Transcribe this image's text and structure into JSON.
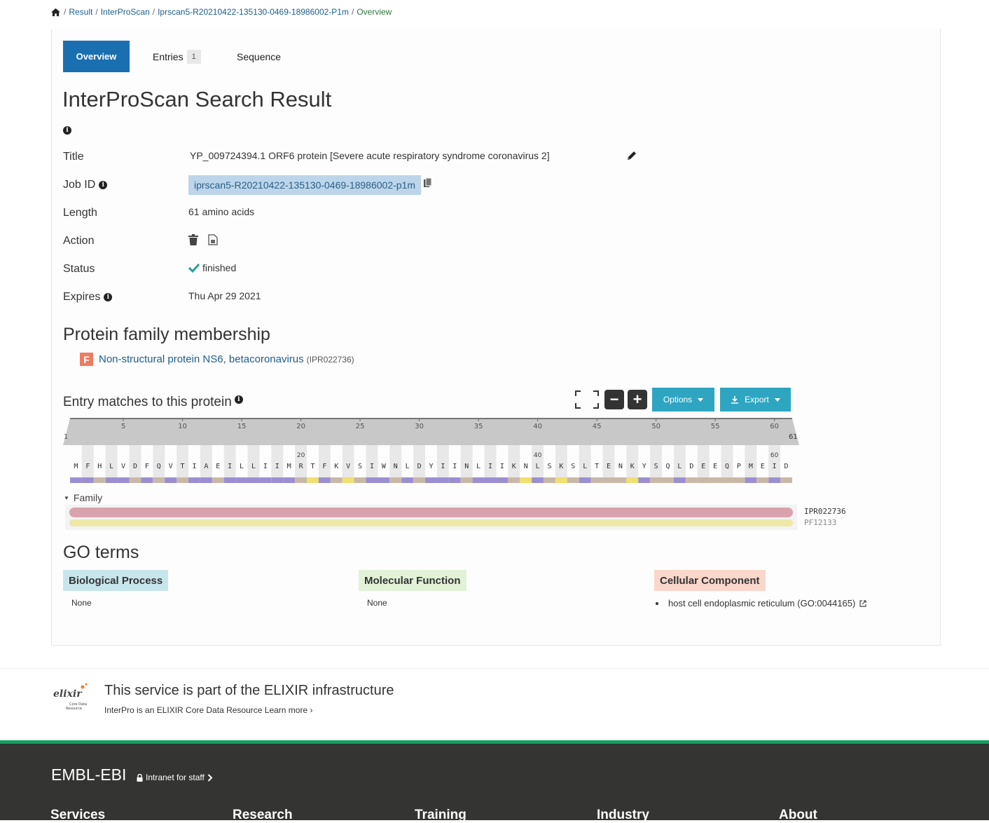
{
  "breadcrumb": {
    "items": [
      "Result",
      "InterProScan",
      "Iprscan5-R20210422-135130-0469-18986002-P1m"
    ],
    "current": "Overview",
    "separator": "/"
  },
  "tabs": {
    "overview": "Overview",
    "entries": "Entries",
    "entries_count": "1",
    "sequence": "Sequence"
  },
  "page_title": "InterProScan Search Result",
  "details": {
    "title_label": "Title",
    "title_value": "YP_009724394.1 ORF6 protein [Severe acute respiratory syndrome coronavirus 2]",
    "jobid_label": "Job ID",
    "jobid_value": "iprscan5-R20210422-135130-0469-18986002-p1m",
    "length_label": "Length",
    "length_value": "61 amino acids",
    "action_label": "Action",
    "status_label": "Status",
    "status_value": "finished",
    "expires_label": "Expires",
    "expires_value": "Thu Apr 29 2021"
  },
  "family": {
    "heading": "Protein family membership",
    "badge": "F",
    "name": "Non-structural protein NS6, betacoronavirus",
    "accession": "(IPR022736)"
  },
  "matches": {
    "heading": "Entry matches to this protein",
    "options_label": "Options",
    "export_label": "Export",
    "ruler_ticks": [
      "5",
      "10",
      "15",
      "20",
      "25",
      "30",
      "35",
      "40",
      "45",
      "50",
      "55",
      "60"
    ],
    "ruler_start": "1",
    "ruler_end": "61",
    "sequence": "MFHLVDFQVTIAEILLIIMRTFKVSIWNLDYIINLIIKNLSKSLTENKYSQLDEEQPMEID",
    "seq_markers": [
      "20",
      "40",
      "60"
    ],
    "track_group": "Family",
    "tracks": [
      {
        "label": "IPR022736",
        "color": "#d9a3ae"
      },
      {
        "label": "PF12133",
        "color": "#ede8a8"
      }
    ]
  },
  "go": {
    "heading": "GO terms",
    "bp_label": "Biological Process",
    "bp_value": "None",
    "mf_label": "Molecular Function",
    "mf_value": "None",
    "cc_label": "Cellular Component",
    "cc_value": "host cell endoplasmic reticulum (GO:0044165)",
    "bp_color": "#c7e6ec",
    "mf_color": "#e1f2d7",
    "cc_color": "#fad7cb"
  },
  "elixir": {
    "title": "This service is part of the ELIXIR infrastructure",
    "subtitle": "InterPro is an ELIXIR Core Data Resource",
    "learn_more": "Learn more ›",
    "logo_text": "elixir",
    "logo_sub1": "Core Data",
    "logo_sub2": "Resource"
  },
  "footer": {
    "brand": "EMBL-EBI",
    "intranet": "Intranet for staff",
    "columns": [
      "Services",
      "Research",
      "Training",
      "Industry",
      "About"
    ]
  }
}
